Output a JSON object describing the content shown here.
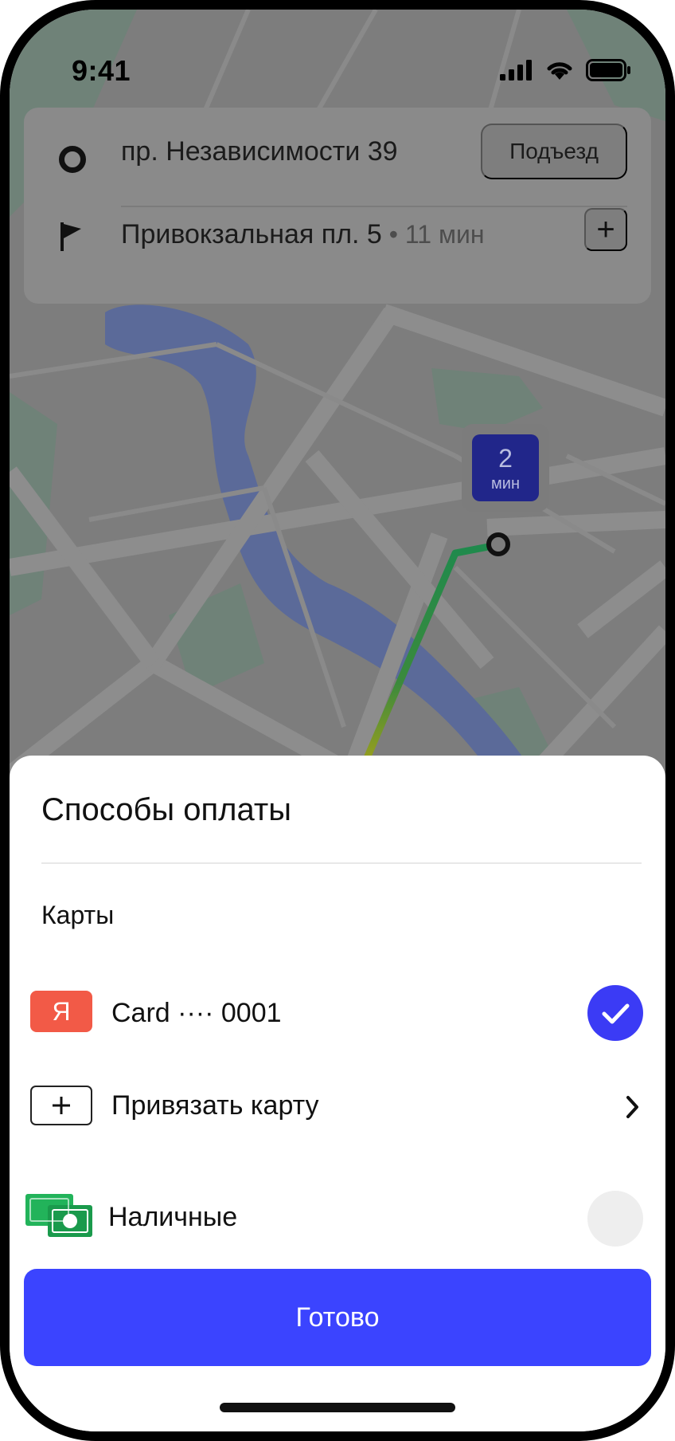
{
  "status_bar": {
    "time": "9:41"
  },
  "route": {
    "from_address": "пр. Независимости 39",
    "porch_button": "Подъезд",
    "to_address": "Привокзальная пл. 5",
    "to_eta": " • 11 мин",
    "add_stop": "+"
  },
  "map": {
    "eta_value": "2",
    "eta_unit": "мин"
  },
  "sheet": {
    "title": "Способы оплаты",
    "section_cards": "Карты",
    "card_logo_letter": "Я",
    "card_label": "Card ···· 0001",
    "link_card_label": "Привязать карту",
    "cash_label": "Наличные",
    "done_button": "Готово"
  },
  "colors": {
    "accent": "#3B44FF",
    "card_logo": "#F25A47",
    "cash_icon": "#1DB954"
  }
}
